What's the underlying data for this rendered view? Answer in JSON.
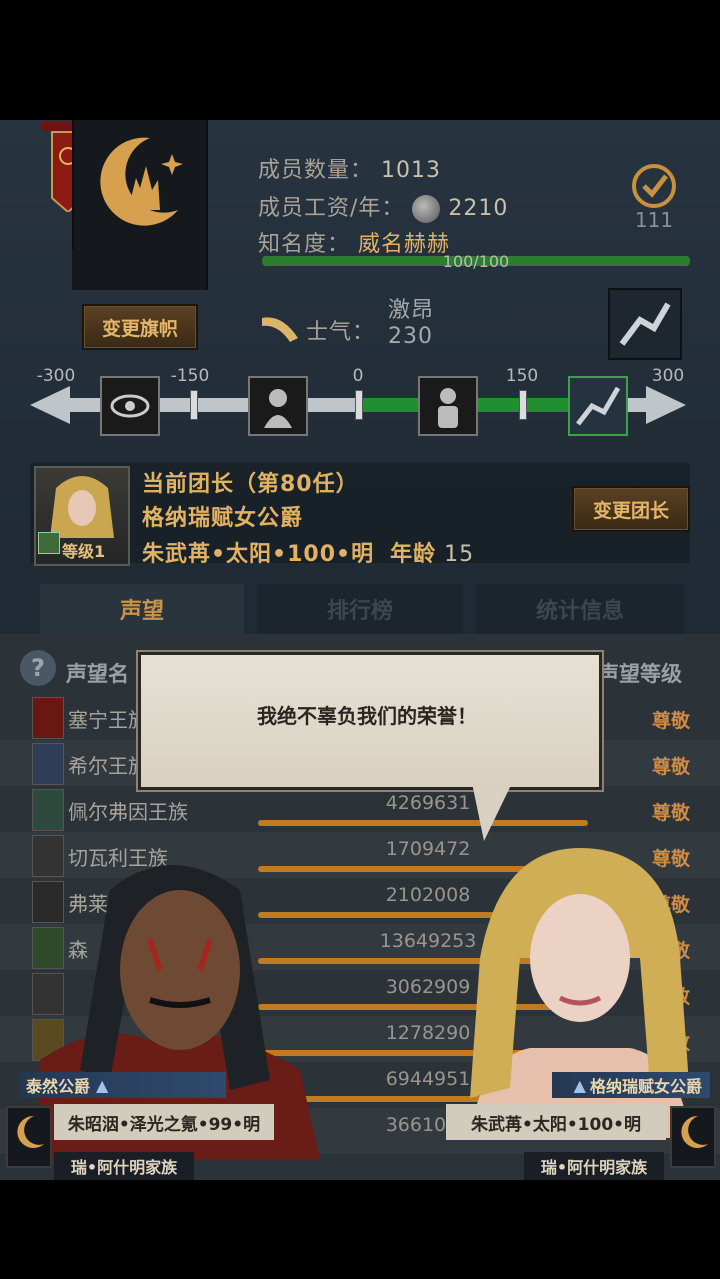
{
  "guild": {
    "members_label": "成员数量：",
    "members_value": "1013",
    "wage_label": "成员工资/年：",
    "wage_value": "2210",
    "fame_label": "知名度：",
    "fame_value": "威名赫赫",
    "fame_progress_text": "100/100",
    "fame_progress": 1.0,
    "badge_count": "111",
    "change_banner_label": "变更旗帜"
  },
  "morale": {
    "label": "士气：",
    "state": "激昂",
    "value": "230",
    "scale_ticks": [
      "-300",
      "-150",
      "0",
      "150",
      "300"
    ],
    "moods": [
      "eye-icon",
      "despair-icon",
      "calm-icon",
      "charge-icon"
    ]
  },
  "leader": {
    "heading": "当前团长（第80任）",
    "title": "格纳瑞赋女公爵",
    "name": "朱武苒•太阳•100•明",
    "age_label": "年龄",
    "age_value": "15",
    "level_label": "等级1",
    "change_label": "变更团长"
  },
  "tabs": [
    {
      "label": "声望",
      "active": true
    },
    {
      "label": "排行榜",
      "active": false
    },
    {
      "label": "统计信息",
      "active": false
    }
  ],
  "reputation": {
    "col_name": "声望名",
    "col_rank": "声望等级",
    "rows": [
      {
        "name": "塞宁王族",
        "value": "",
        "rank": "尊敬"
      },
      {
        "name": "希尔王族",
        "value": "",
        "rank": "尊敬"
      },
      {
        "name": "佩尔弗因王族",
        "value": "4269631",
        "rank": "尊敬"
      },
      {
        "name": "切瓦利王族",
        "value": "1709472",
        "rank": "尊敬"
      },
      {
        "name": "弗莱",
        "value": "2102008",
        "rank": "尊敬"
      },
      {
        "name": "森",
        "value": "13649253",
        "rank": "尊敬"
      },
      {
        "name": "",
        "value": "3062909",
        "rank": "尊敬"
      },
      {
        "name": "",
        "value": "1278290",
        "rank": "尊敬"
      },
      {
        "name": "",
        "value": "6944951",
        "rank": ""
      },
      {
        "name": "",
        "value": "3661051",
        "rank": ""
      }
    ]
  },
  "dialog": {
    "text": "我绝不辜负我们的荣誉！"
  },
  "left_char": {
    "title": "泰然公爵",
    "name": "朱昭洇•泽光之氪•99•明",
    "family": "瑞•阿什明家族"
  },
  "right_char": {
    "title": "格纳瑞赋女公爵",
    "name": "朱武苒•太阳•100•明",
    "family": "瑞•阿什明家族"
  }
}
